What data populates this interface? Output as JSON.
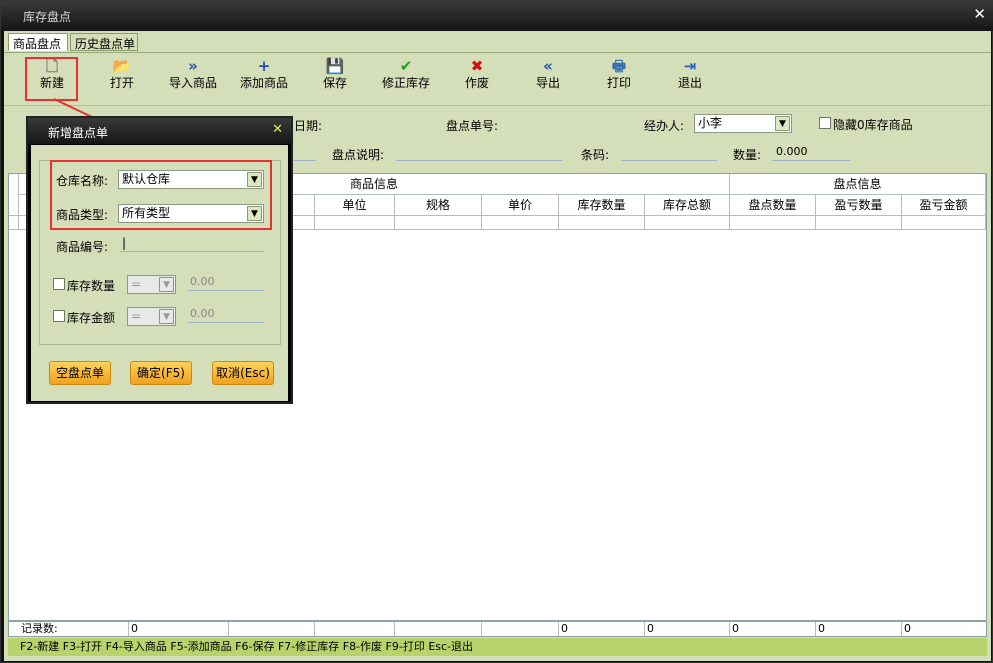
{
  "window": {
    "title": "库存盘点"
  },
  "tabs": [
    {
      "label": "商品盘点"
    },
    {
      "label": "历史盘点单"
    }
  ],
  "toolbar": {
    "buttons": [
      {
        "label": "新建",
        "icon": "new-doc-icon"
      },
      {
        "label": "打开",
        "icon": "open-folder-icon"
      },
      {
        "label": "导入商品",
        "icon": "double-chevron-right-icon"
      },
      {
        "label": "添加商品",
        "icon": "plus-icon"
      },
      {
        "label": "保存",
        "icon": "save-icon"
      },
      {
        "label": "修正库存",
        "icon": "checkmark-icon"
      },
      {
        "label": "作废",
        "icon": "x-mark-icon"
      },
      {
        "label": "导出",
        "icon": "double-chevron-left-icon"
      },
      {
        "label": "打印",
        "icon": "printer-icon"
      },
      {
        "label": "退出",
        "icon": "exit-door-icon"
      }
    ]
  },
  "form": {
    "date_label": "日期:",
    "order_no_label": "盘点单号:",
    "handler_label": "经办人:",
    "handler_value": "小李",
    "hide_zero_label": "隐藏0库存商品",
    "desc_label": "盘点说明:",
    "barcode_label": "条码:",
    "qty_label": "数量:",
    "qty_value": "0.000"
  },
  "grid": {
    "group_headers": {
      "product_info": "商品信息",
      "count_info": "盘点信息"
    },
    "columns": [
      "单位",
      "规格",
      "单价",
      "库存数量",
      "库存总额",
      "盘点数量",
      "盈亏数量",
      "盈亏金额"
    ]
  },
  "footer": {
    "record_count_label": "记录数:",
    "record_count_value": "0",
    "totals": [
      "0",
      "0",
      "0",
      "0",
      "0"
    ]
  },
  "status_bar": "F2-新建 F3-打开 F4-导入商品 F5-添加商品 F6-保存 F7-修正库存 F8-作废 F9-打印 Esc-退出",
  "dialog": {
    "title": "新增盘点单",
    "warehouse_label": "仓库名称:",
    "warehouse_value": "默认仓库",
    "category_label": "商品类型:",
    "category_value": "所有类型",
    "code_label": "商品编号:",
    "code_value": "|",
    "stock_qty_label": "库存数量",
    "stock_qty_op": "=",
    "stock_qty_value": "0.00",
    "stock_amt_label": "库存金额",
    "stock_amt_op": "=",
    "stock_amt_value": "0.00",
    "btn_empty": "空盘点单",
    "btn_ok": "确定(F5)",
    "btn_cancel": "取消(Esc)"
  },
  "colors": {
    "annotation_red": "#e83030",
    "panel_green": "#d4deb8",
    "status_green": "#b8d26c"
  }
}
